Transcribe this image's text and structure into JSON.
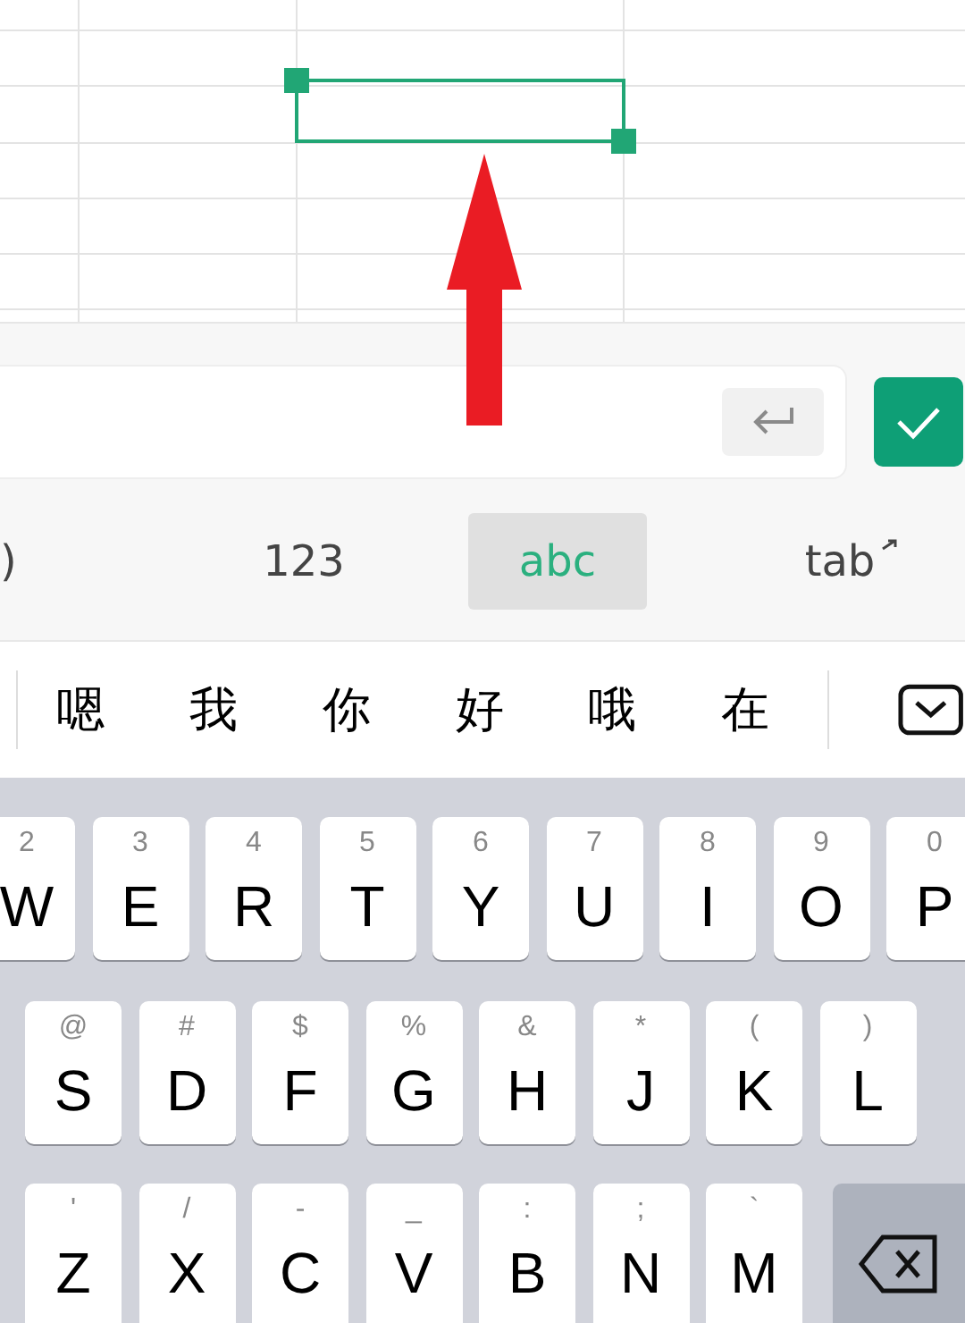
{
  "mode_tabs": [
    {
      "label": ")",
      "selected": false
    },
    {
      "label": "123",
      "selected": false
    },
    {
      "label": "abc",
      "selected": true
    },
    {
      "label": "tab",
      "selected": false
    }
  ],
  "candidates": [
    "嗯",
    "我",
    "你",
    "好",
    "哦",
    "在"
  ],
  "keyboard": {
    "rows": [
      [
        {
          "main": "W",
          "alt": "2"
        },
        {
          "main": "E",
          "alt": "3"
        },
        {
          "main": "R",
          "alt": "4"
        },
        {
          "main": "T",
          "alt": "5"
        },
        {
          "main": "Y",
          "alt": "6"
        },
        {
          "main": "U",
          "alt": "7"
        },
        {
          "main": "I",
          "alt": "8"
        },
        {
          "main": "O",
          "alt": "9"
        },
        {
          "main": "P",
          "alt": "0"
        }
      ],
      [
        {
          "main": "S",
          "alt": "@"
        },
        {
          "main": "D",
          "alt": "#"
        },
        {
          "main": "F",
          "alt": "$"
        },
        {
          "main": "G",
          "alt": "%"
        },
        {
          "main": "H",
          "alt": "&"
        },
        {
          "main": "J",
          "alt": "*"
        },
        {
          "main": "K",
          "alt": "("
        },
        {
          "main": "L",
          "alt": ")"
        }
      ],
      [
        {
          "main": "Z",
          "alt": "'"
        },
        {
          "main": "X",
          "alt": "/"
        },
        {
          "main": "C",
          "alt": "-"
        },
        {
          "main": "V",
          "alt": "_"
        },
        {
          "main": "B",
          "alt": ":"
        },
        {
          "main": "N",
          "alt": ";"
        },
        {
          "main": "M",
          "alt": "`"
        }
      ]
    ]
  }
}
